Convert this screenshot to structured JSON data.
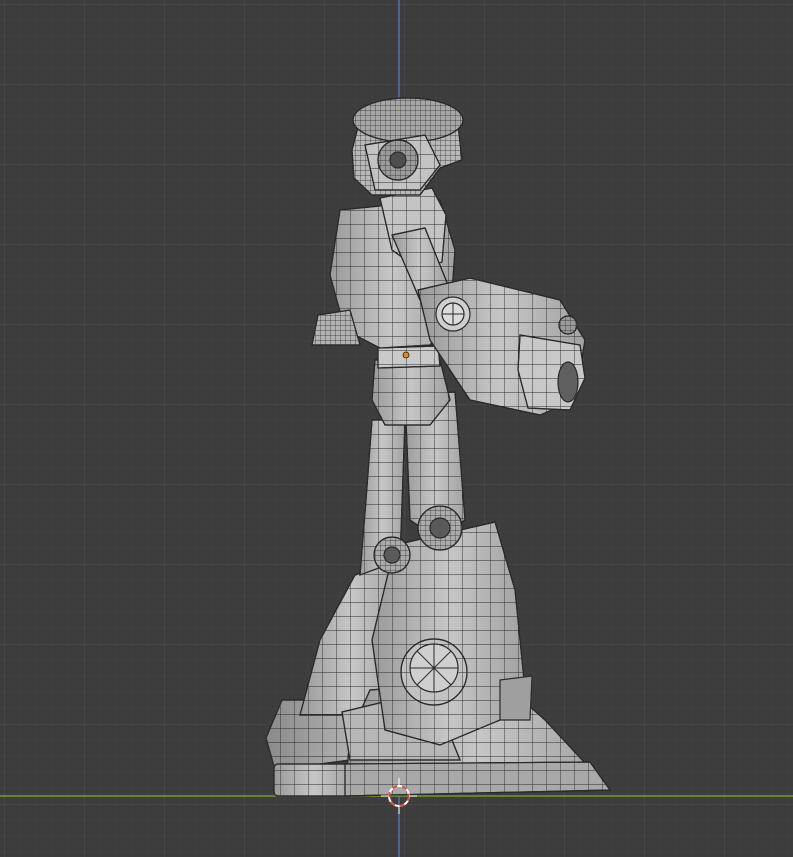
{
  "viewport": {
    "background": "#3d3d3d",
    "grid_minor_color": "#444444",
    "grid_major_color": "#4e4e4e",
    "x_axis_color": "#6f9a35",
    "z_axis_color": "#5b7fc2"
  },
  "model": {
    "surface_color": "#b9b9b9",
    "shadow_color": "#8e8e8e",
    "wire_color": "#2a2a2a",
    "origin_color": "#e38a1e"
  },
  "cursor": {
    "ring_color_a": "#e04a3a",
    "ring_color_b": "#ffffff"
  }
}
